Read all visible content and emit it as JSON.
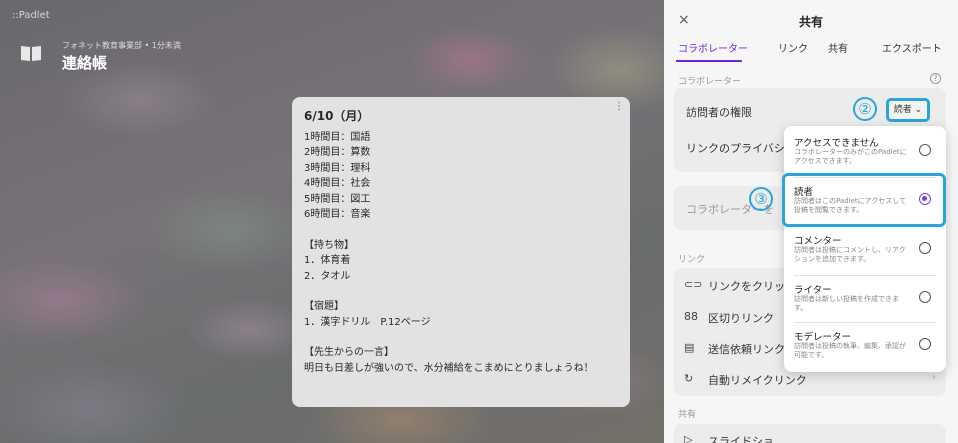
{
  "board": {
    "brand": "::Padlet",
    "subtitle": "フォネット教育事業部 • 1分未満",
    "title": "連絡帳"
  },
  "post": {
    "title": "6/10（月）",
    "menu_icon": "more-vertical-icon",
    "lines": [
      "1時間目：国語",
      "2時間目：算数",
      "3時間目：理科",
      "4時間目：社会",
      "5時間目：図工",
      "6時間目：音楽",
      "",
      "【持ち物】",
      "1．体育着",
      "2．タオル",
      "",
      "【宿題】",
      "1．漢字ドリル　P.12ページ",
      "",
      "【先生からの一言】",
      "明日も日差しが強いので、水分補給をこまめにとりましょうね！"
    ]
  },
  "panel": {
    "close": "×",
    "title": "共有",
    "tabs": [
      "コラボレーター",
      "リンク",
      "共有",
      "エクスポート"
    ],
    "active_tab": 0,
    "collab_section": "コラボレーター",
    "help": "?",
    "visitor_permission": "訪問者の権限",
    "visitor_value": "読者",
    "link_privacy": "リンクのプライバシ",
    "add_collab_placeholder": "コラボレーターを",
    "link_section": "リンク",
    "link_rows": [
      {
        "icon": "link-icon",
        "glyph": "⊂⊃",
        "label": "リンクをクリッ"
      },
      {
        "icon": "grid-icon",
        "glyph": "88",
        "label": "区切りリンク"
      },
      {
        "icon": "request-icon",
        "glyph": "▤",
        "label": "送信依頼リンク"
      },
      {
        "icon": "remake-icon",
        "glyph": "↻",
        "label": "自動リメイクリンク"
      }
    ],
    "share_section": "共有",
    "slideshow": "スライドショ"
  },
  "callouts": {
    "two": "②",
    "three": "③"
  },
  "dropdown": {
    "options": [
      {
        "title": "アクセスできません",
        "desc": "コラボレーターのみがこのPadletにアクセスできます。",
        "selected": false
      },
      {
        "title": "読者",
        "desc": "訪問者はこのPadletにアクセスして投稿を閲覧できます。",
        "selected": true
      },
      {
        "title": "コメンター",
        "desc": "訪問者は投稿にコメントし、リアクションを追加できます。",
        "selected": false
      },
      {
        "title": "ライター",
        "desc": "訪問者は新しい投稿を作成できます。",
        "selected": false
      },
      {
        "title": "モデレーター",
        "desc": "訪問者は投稿の執筆、編集、承認が可能です。",
        "selected": false
      }
    ]
  },
  "colors": {
    "accent": "#6d28d9",
    "callout": "#2aa6d6"
  }
}
